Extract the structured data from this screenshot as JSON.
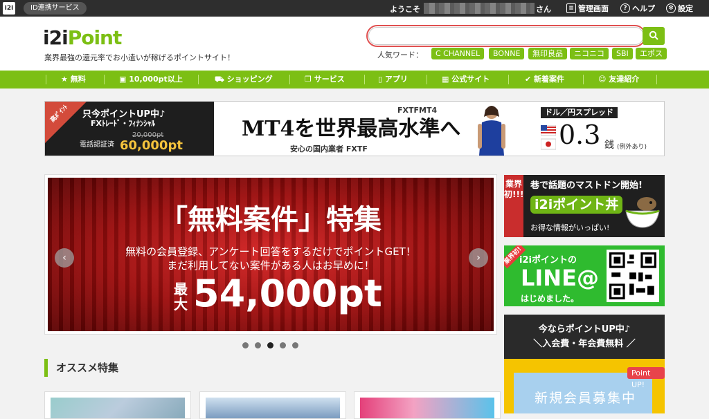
{
  "topbar": {
    "logo": "i2i",
    "id_service": "ID連携サービス",
    "welcome": "ようこそ",
    "san": "さん",
    "admin": "管理画面",
    "help": "ヘルプ",
    "settings": "設定"
  },
  "header": {
    "logo_main": "i2i",
    "logo_point": "Point",
    "tagline": "業界最強の還元率でお小遣いが稼げるポイントサイト！",
    "search_placeholder": "",
    "popular_label": "人気ワード：",
    "popular_words": [
      "C CHANNEL",
      "BONNE",
      "無印良品",
      "ニコニコ",
      "SBI",
      "エポス"
    ]
  },
  "nav": {
    "items": [
      "無料",
      "10,000pt以上",
      "ショッピング",
      "サービス",
      "アプリ",
      "公式サイト",
      "新着案件",
      "友達紹介"
    ],
    "icons": [
      "star-icon",
      "cash-icon",
      "cart-icon",
      "copy-icon",
      "phone-icon",
      "building-icon",
      "check-icon",
      "friends-icon"
    ]
  },
  "top_banner": {
    "ribbon": "高ﾎﾟｲﾝﾄ",
    "line1": "只今ポイントUP中♪",
    "line2": "FXﾄﾚｰﾄﾞ・ﾌｨﾅﾝｼｬﾙ",
    "line3": "電話認証済",
    "old_points": "20,000pt",
    "new_points": "60,000pt",
    "mt4_text": "MT4を世界最高水準へ",
    "fxtf_logo": "FXTFMT4",
    "anshin": "安心の国内業者 FXTF",
    "spread_label": "ドル／円スプレッド",
    "spread_value": "0.3",
    "spread_unit": "銭",
    "spread_note": "(例外あり)"
  },
  "slider": {
    "title": "「無料案件」特集",
    "sub1": "無料の会員登録、アンケート回答をするだけでポイントGET！",
    "sub2": "まだ利用してない案件がある人はお早めに！",
    "max_label": "最大",
    "amount": "54,000pt",
    "prev": "‹",
    "next": "›",
    "active_dot": 2,
    "dot_count": 5
  },
  "section": {
    "title": "オススメ特集"
  },
  "side": {
    "mastodon_tag": "業界初!!!",
    "mastodon_l1": "巷で話題のマストドン開始!",
    "mastodon_l2": "i2iポイント丼",
    "mastodon_l3": "お得な情報がいっぱい!",
    "line_tag": "業界初!",
    "line_l1": "i2iポイントの",
    "line_l2": "LINE@",
    "line_l3": "はじめました。",
    "promo_l1": "今ならポイントUP中♪",
    "promo_l2": "＼入会費・年会費無料 ／",
    "promo_boshu": "新規会員募集中",
    "promo_badge": "Point UP!"
  }
}
